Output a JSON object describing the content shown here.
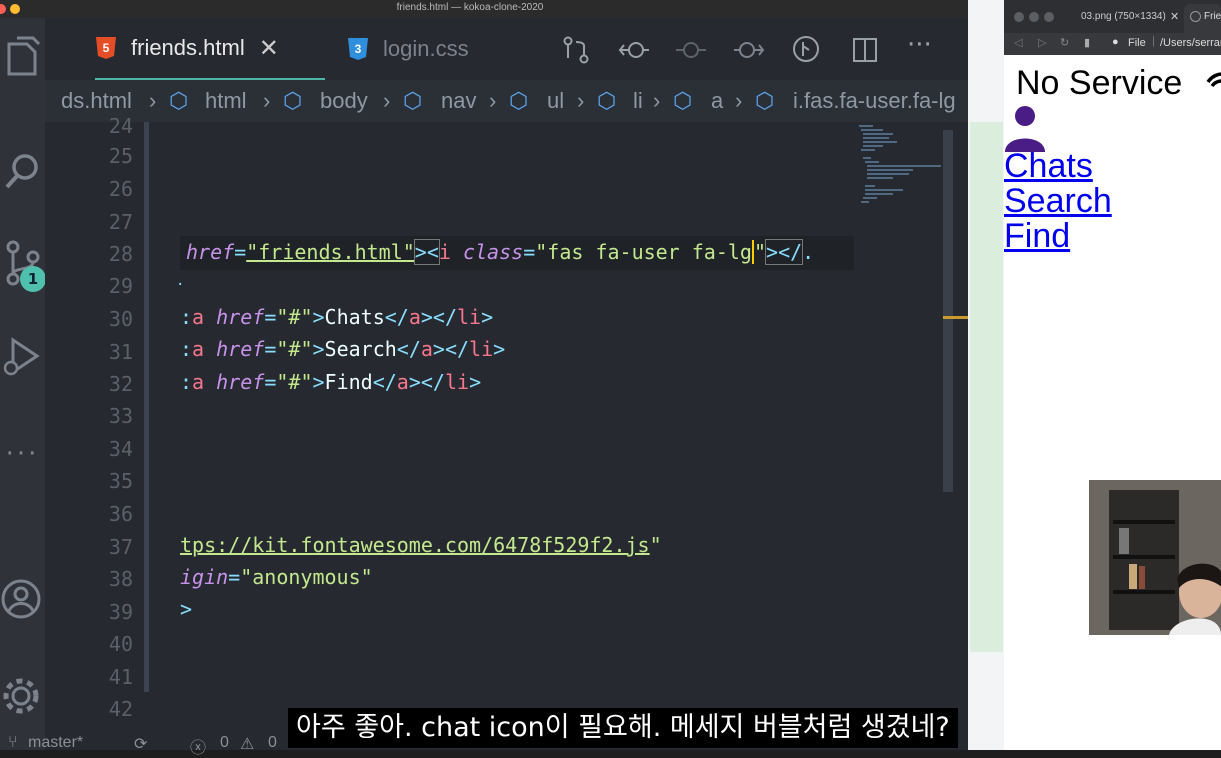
{
  "window": {
    "title": "friends.html — kokoa-clone-2020"
  },
  "tabs": [
    {
      "label": "friends.html",
      "icon": "html5-icon",
      "active": true
    },
    {
      "label": "login.css",
      "icon": "css3-icon",
      "active": false
    }
  ],
  "activity": {
    "source_control_badge": "1"
  },
  "breadcrumb": [
    "ds.html",
    "html",
    "body",
    "nav",
    "ul",
    "li",
    "a",
    "i.fas.fa-user.fa-lg"
  ],
  "line_numbers": [
    "24",
    "25",
    "26",
    "27",
    "28",
    "29",
    "30",
    "31",
    "32",
    "33",
    "34",
    "35",
    "36",
    "37",
    "38",
    "39",
    "40",
    "41",
    "42"
  ],
  "code": {
    "l28": {
      "p1": "href",
      "p2": "=",
      "p3": "\"friends.html\"",
      "p4": "><",
      "p5": "i",
      "p6": " class",
      "p7": "=",
      "p8": "\"fas fa-user fa-lg",
      "p9": "\"",
      "p10": "></",
      "p11": "."
    },
    "l29": ".",
    "l30": {
      "a": "a",
      "attr": "href",
      "val": "\"#\"",
      "text": "Chats"
    },
    "l31": {
      "a": "a",
      "attr": "href",
      "val": "\"#\"",
      "text": "Search"
    },
    "l32": {
      "a": "a",
      "attr": "href",
      "val": "\"#\"",
      "text": "Find"
    },
    "l37": {
      "url": "tps://kit.fontawesome.com/6478f529f2.js",
      "q": "\""
    },
    "l38": {
      "attr": "igin",
      "eq": "=",
      "val": "\"anonymous\""
    },
    "l39": ">"
  },
  "status": {
    "branch": "master*",
    "errors": "0",
    "warnings": "0"
  },
  "browser": {
    "tab1": "03.png (750×1334)",
    "tab2": "Frie",
    "address_scheme": "File",
    "address_path": "/Users/serran",
    "page": {
      "heading": "No Service",
      "links": [
        "Chats",
        "Search",
        "Find"
      ]
    }
  },
  "subtitle": "아주 좋아. chat icon이 필요해. 메세지 버블처럼 생겼네?",
  "colors": {
    "tag": "#f7768e",
    "attr": "#c792ea",
    "string": "#c3e88d",
    "punct": "#89ddff",
    "accent": "#c99a2e"
  }
}
